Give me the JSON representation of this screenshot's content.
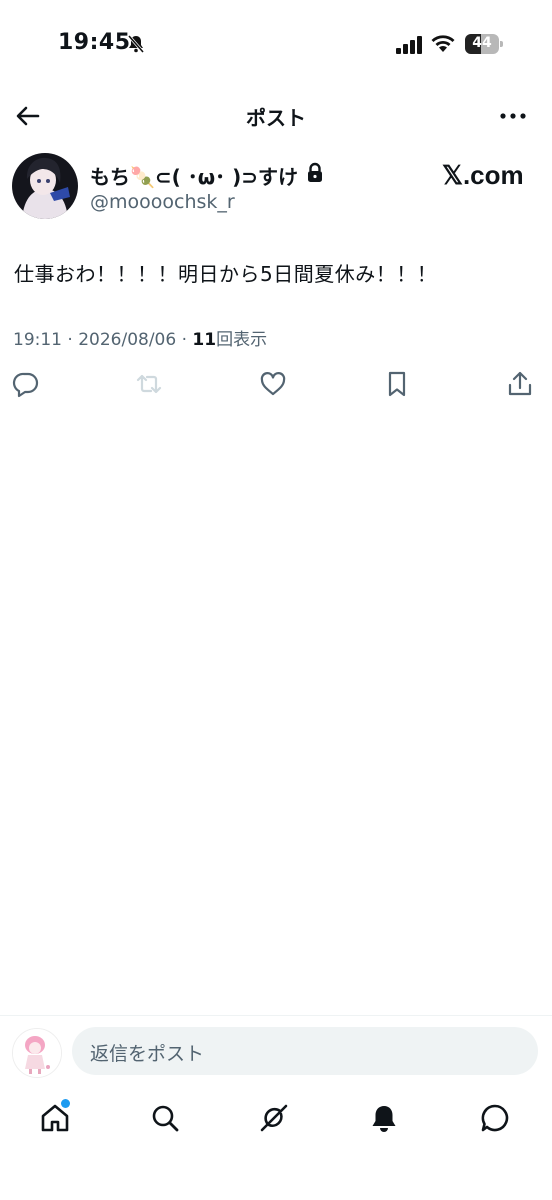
{
  "status_bar": {
    "time": "19:45",
    "battery": "44"
  },
  "header": {
    "title": "ポスト"
  },
  "post": {
    "author_name": "もち🍡⊂( ･ω･ )⊃すけ",
    "author_handle": "@moooochsk_r",
    "brand": "𝕏.com",
    "text": "仕事おわ！！！！明日から5日間夏休み！！！",
    "meta_prefix": "19:11 · 2026/08/06 · ",
    "views_count": "11",
    "views_label": "回表示"
  },
  "reply": {
    "placeholder": "返信をポスト"
  },
  "icons": {
    "back": "arrow-left-icon",
    "more": "more-horizontal-icon",
    "lock": "lock-icon",
    "reply": "reply-bubble-icon",
    "repost": "repost-icon",
    "like": "heart-icon",
    "bookmark": "bookmark-icon",
    "share": "share-icon",
    "home": "home-icon",
    "search": "search-icon",
    "grok": "grok-icon",
    "notifications": "bell-icon",
    "messages": "message-icon"
  },
  "colors": {
    "accent": "#1d9bf0",
    "text": "#0f1419",
    "muted": "#536471",
    "disabled": "#cfd9de"
  }
}
